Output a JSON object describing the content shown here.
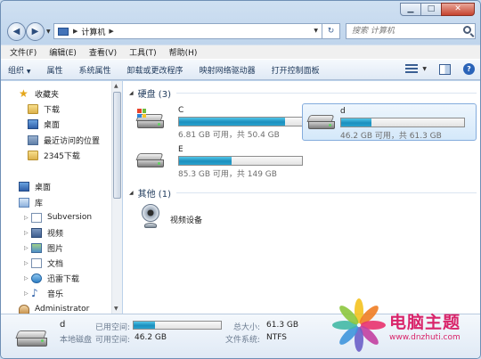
{
  "window": {
    "caption": {
      "minimize": "▁",
      "maximize": "□",
      "close": "✕"
    }
  },
  "address": {
    "path": [
      "计算机"
    ],
    "search_placeholder": "搜索 计算机"
  },
  "menubar": {
    "items": [
      "文件(F)",
      "编辑(E)",
      "查看(V)",
      "工具(T)",
      "帮助(H)"
    ]
  },
  "commandbar": {
    "items": [
      "组织",
      "属性",
      "系统属性",
      "卸载或更改程序",
      "映射网络驱动器",
      "打开控制面板"
    ],
    "organize_arrow": "▼",
    "help": "?"
  },
  "navpane": {
    "favorites": {
      "label": "收藏夹",
      "items": [
        "下载",
        "桌面",
        "最近访问的位置",
        "2345下载"
      ]
    },
    "desktop": {
      "label": "桌面"
    },
    "libraries": {
      "label": "库",
      "items": [
        "Subversion",
        "视频",
        "图片",
        "文档",
        "迅雷下载",
        "音乐"
      ]
    },
    "user": {
      "label": "Administrator"
    }
  },
  "content": {
    "hdd_group": {
      "label": "硬盘 (3)"
    },
    "drives": [
      {
        "name": "C",
        "info": "6.81 GB 可用，共 50.4 GB",
        "used_fraction": 0.865
      },
      {
        "name": "d",
        "info": "46.2 GB 可用，共 61.3 GB",
        "used_fraction": 0.246
      },
      {
        "name": "E",
        "info": "85.3 GB 可用，共 149 GB",
        "used_fraction": 0.428
      }
    ],
    "other_group": {
      "label": "其他 (1)"
    },
    "other_items": [
      {
        "name": "视频设备"
      }
    ]
  },
  "details": {
    "name": "d",
    "type": "本地磁盘",
    "used_label": "已用空间:",
    "free_label": "可用空间:",
    "free_value": "46.2 GB",
    "used_fraction": 0.246,
    "total_label": "总大小:",
    "total_value": "61.3 GB",
    "fs_label": "文件系统:",
    "fs_value": "NTFS"
  },
  "watermark": {
    "title": "电脑主题",
    "url": "www.dnzhuti.com"
  },
  "colors": {
    "bar_fill": "#1c8fbe",
    "selection": "#d4e8fa",
    "watermark": "#d9246a"
  }
}
